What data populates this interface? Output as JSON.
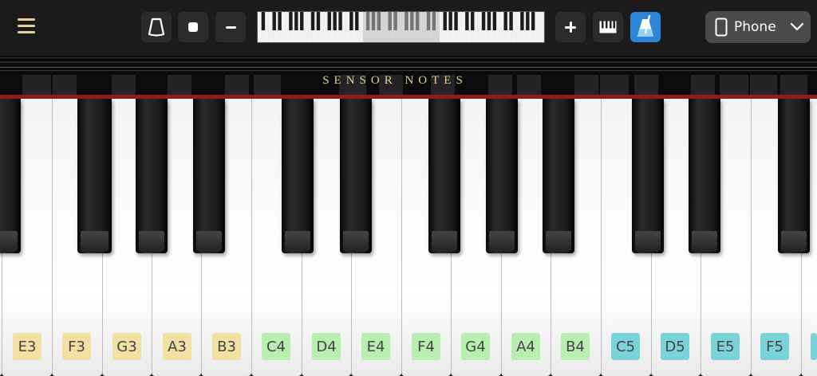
{
  "toolbar": {
    "menu_icon": "hamburger-menu-icon",
    "accent_color": "#e7cf97",
    "active_color": "#2d87d8",
    "buttons": [
      {
        "name": "metronome-button",
        "icon": "metronome-icon"
      },
      {
        "name": "stop-button",
        "icon": "stop-icon"
      },
      {
        "name": "zoom-out-button",
        "icon": "minus-icon"
      },
      {
        "name": "zoom-in-button",
        "icon": "plus-icon"
      },
      {
        "name": "keyboard-layout-button",
        "icon": "piano-keys-icon"
      },
      {
        "name": "metronome-toggle-button",
        "icon": "metronome-icon",
        "active": true
      }
    ],
    "device": {
      "icon": "phone-icon",
      "label": "Phone",
      "dropdown_icon": "chevron-down-icon"
    }
  },
  "brand": {
    "text": "SENSOR NOTES"
  },
  "keyboard": {
    "white_keys": [
      "E3",
      "F3",
      "G3",
      "A3",
      "B3",
      "C4",
      "D4",
      "E4",
      "F4",
      "G4",
      "A4",
      "B4",
      "C5",
      "D5",
      "E5",
      "F5"
    ],
    "label_colors": {
      "3": "#f2e1a2",
      "4": "#b8efb0",
      "5": "#79d3d8"
    }
  }
}
